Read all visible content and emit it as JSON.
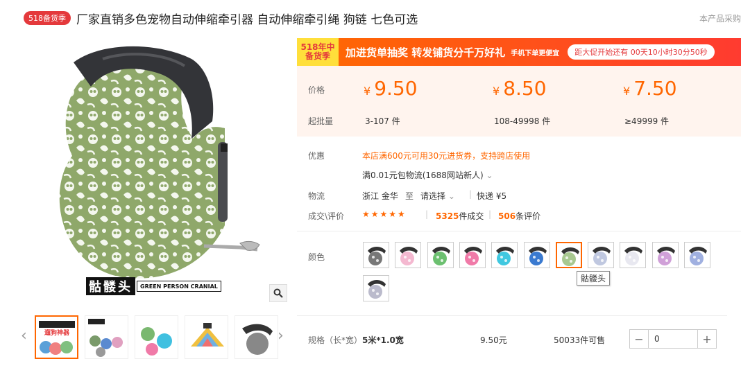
{
  "header": {
    "badge": "518备货季",
    "title": "厂家直销多色宠物自动伸缩牵引器 自动伸缩牵引绳 狗链 七色可选",
    "notice": "本产品采购"
  },
  "gallery": {
    "brand_cn": "骷髅头",
    "brand_en": "GREEN PERSON CRANIAL",
    "thumb_colors": [
      "#5aa0d8",
      "#7a9a6a",
      "#7ab870",
      "#f0c040",
      "#888888"
    ]
  },
  "banner": {
    "badge_line1": "518年中",
    "badge_line2": "备货季",
    "text": "加进货单抽奖 转发铺货分千万好礼",
    "sub": "手机下单更便宜",
    "countdown": "距大促开始还有 00天10小时30分50秒"
  },
  "pricing": {
    "price_label": "价格",
    "qty_label": "起批量",
    "currency": "¥",
    "tiers": [
      {
        "price": "9.50",
        "qty": "3-107 件"
      },
      {
        "price": "8.50",
        "qty": "108-49998 件"
      },
      {
        "price": "7.50",
        "qty": "≥49999 件"
      }
    ]
  },
  "info": {
    "discount_label": "优惠",
    "discount_text": "本店满600元可用30元进货券，支持跨店使用",
    "shipping_promo": "满0.01元包物流(1688网站新人)",
    "logistics_label": "物流",
    "origin": "浙江 金华",
    "to": "至",
    "destination": "请选择",
    "express": "快递 ¥5",
    "deal_label": "成交\\评价",
    "stars": "★★★★★",
    "deals_count": "5325",
    "deals_suffix": "件成交",
    "reviews_count": "506",
    "reviews_suffix": "条评价"
  },
  "colors": {
    "label": "颜色",
    "tooltip": "骷髅头",
    "swatch_colors": [
      "#777777",
      "#f4b8d0",
      "#6cc070",
      "#f07aa8",
      "#40c8e0",
      "#3a7ad0",
      "#a8c890",
      "#c0c8e0",
      "#e8e8f0",
      "#d0a0d8",
      "#a0b0e0",
      "#bbbbcc"
    ]
  },
  "spec": {
    "label": "规格（长*宽）",
    "value": "5米*1.0宽",
    "price": "9.50元",
    "stock": "50033件可售",
    "quantity": "0",
    "minus": "−",
    "plus": "+"
  },
  "theme": {
    "accent": "#ff6600",
    "banner_red": "#ff3b30",
    "price_bg": "#fff4ee"
  }
}
